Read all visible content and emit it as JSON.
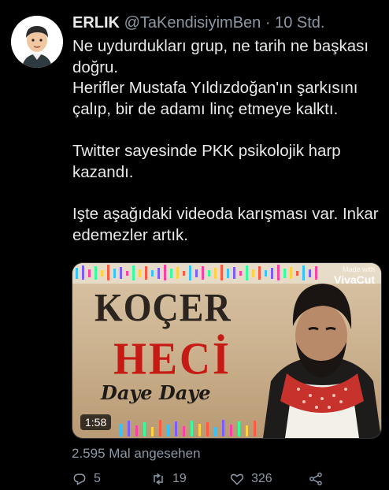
{
  "author": {
    "name": "ERLIK",
    "handle": "@TaKendisiyimBen",
    "separator": "·",
    "time": "10 Std."
  },
  "tweet": {
    "lines": [
      "Ne uydurdukları grup, ne tarih ne başkası doğru.",
      "Herifler Mustafa Yıldızdoğan'ın şarkısını çalıp, bir de adamı linç etmeye kalktı.",
      "Twitter sayesinde PKK psikolojik harp kazandı.",
      "Işte aşağıdaki videoda karışması var. Inkar edemezler artık."
    ]
  },
  "media": {
    "title_line1": "KOÇER",
    "title_line2": "HECİ",
    "subtitle": "Daye Daye",
    "watermark_small": "Made with",
    "watermark_big": "VivaCut",
    "duration": "1:58"
  },
  "stats": {
    "views": "2.595 Mal angesehen"
  },
  "actions": {
    "reply_count": "5",
    "retweet_count": "19",
    "like_count": "326"
  },
  "icons": {
    "reply": "reply-icon",
    "retweet": "retweet-icon",
    "like": "heart-icon",
    "share": "share-icon"
  },
  "colors": {
    "background": "#000000",
    "text": "#e7e9ea",
    "muted": "#8b98a5",
    "title_red": "#c61a15"
  }
}
